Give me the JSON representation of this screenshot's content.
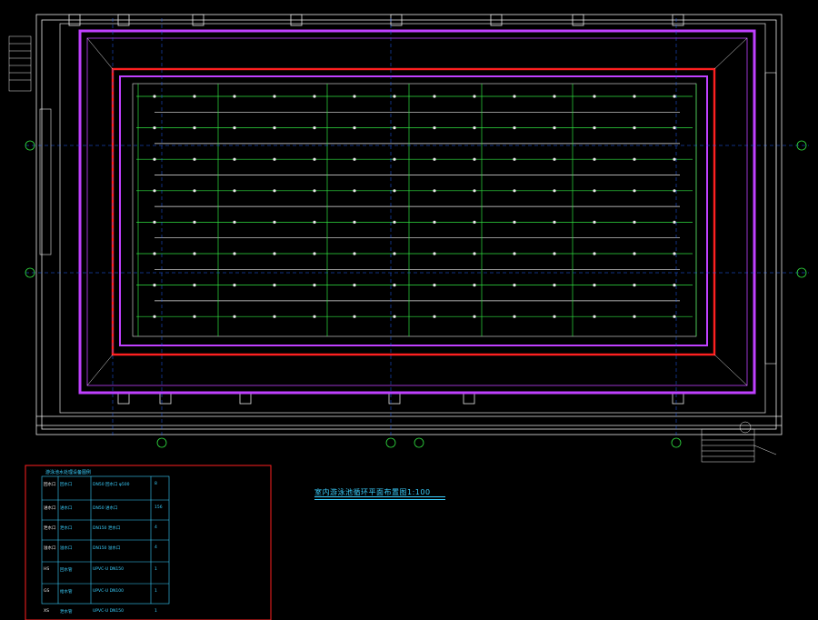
{
  "drawing": {
    "title": "室内游泳池循环平面布置图1:100"
  },
  "legend": {
    "title": "游泳池水处理设备图例",
    "rows": [
      {
        "symbol": "回水口",
        "name": "回水口",
        "spec": "DN50 回水口 φ500",
        "qty": "8"
      },
      {
        "symbol": "进水口",
        "name": "进水口",
        "spec": "DN50 进水口",
        "qty": "156"
      },
      {
        "symbol": "泄水口",
        "name": "泄水口",
        "spec": "DN150 泄水口",
        "qty": "4"
      },
      {
        "symbol": "溢水口",
        "name": "溢水口",
        "spec": "DN150 溢水口",
        "qty": "4"
      },
      {
        "symbol": "HS",
        "name": "回水管",
        "spec": "UPVC-U DN150",
        "qty": "1"
      },
      {
        "symbol": "GS",
        "name": "给水管",
        "spec": "UPVC-U DN100",
        "qty": "1"
      },
      {
        "symbol": "XS",
        "name": "泄水管",
        "spec": "UPVC-U DN150",
        "qty": "1"
      }
    ]
  },
  "colors": {
    "background": "#000000",
    "pool_outer": "#c040ff",
    "pool_red": "#ff2020",
    "pipe_green": "#30e040",
    "wall_white": "#e8e8e8",
    "cyan": "#3ad0ff",
    "grid_blue": "#2060ff",
    "yellow": "#ffe040"
  }
}
